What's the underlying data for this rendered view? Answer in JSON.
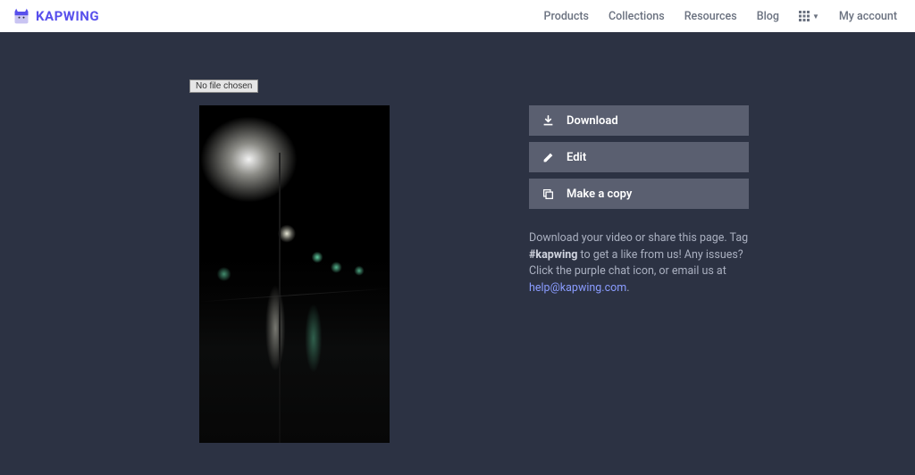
{
  "header": {
    "brand_text": "KAPWING",
    "nav": {
      "products": "Products",
      "collections": "Collections",
      "resources": "Resources",
      "blog": "Blog",
      "my_account": "My account"
    }
  },
  "file_chooser_label": "No file chosen",
  "actions": {
    "download": "Download",
    "edit": "Edit",
    "make_copy": "Make a copy"
  },
  "help": {
    "line1": "Download your video or share this page. Tag ",
    "hashtag": "#kapwing",
    "line2": " to get a like from us! Any issues? Click the purple chat icon, or email us at ",
    "email": "help@kapwing.com",
    "period": "."
  }
}
